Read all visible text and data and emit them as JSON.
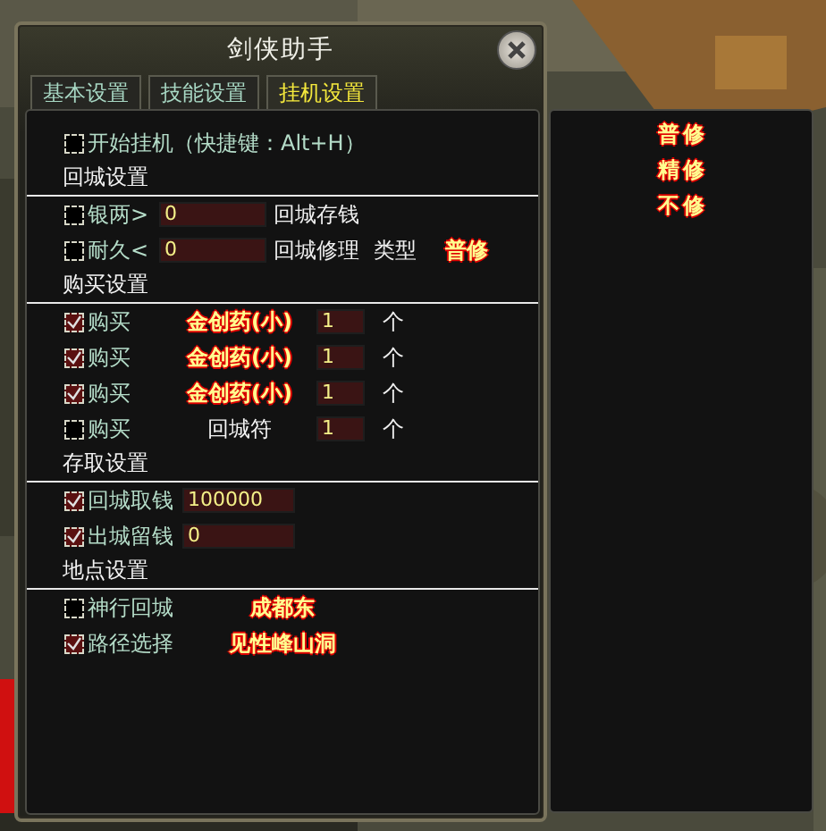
{
  "window": {
    "title": "剑侠助手"
  },
  "tabs": [
    {
      "label": "基本设置",
      "selected": false
    },
    {
      "label": "技能设置",
      "selected": false
    },
    {
      "label": "挂机设置",
      "selected": true
    }
  ],
  "start": {
    "label": "开始挂机（快捷键：Alt+H）",
    "checked": false
  },
  "return_section": {
    "title": "回城设置",
    "silver": {
      "checked": false,
      "label": "银两>",
      "value": "0",
      "action": "回城存钱"
    },
    "durability": {
      "checked": false,
      "label": "耐久<",
      "value": "0",
      "action": "回城修理",
      "type_label": "类型",
      "type_value": "普修"
    }
  },
  "buy_section": {
    "title": "购买设置",
    "items": [
      {
        "checked": true,
        "label": "购买",
        "item": "金创药(小)",
        "highlight": true,
        "quantity": "1",
        "unit": "个"
      },
      {
        "checked": true,
        "label": "购买",
        "item": "金创药(小)",
        "highlight": true,
        "quantity": "1",
        "unit": "个"
      },
      {
        "checked": true,
        "label": "购买",
        "item": "金创药(小)",
        "highlight": true,
        "quantity": "1",
        "unit": "个"
      },
      {
        "checked": false,
        "label": "购买",
        "item": "回城符",
        "highlight": false,
        "quantity": "1",
        "unit": "个"
      }
    ]
  },
  "bank_section": {
    "title": "存取设置",
    "items": [
      {
        "checked": true,
        "label": "回城取钱",
        "value": "100000"
      },
      {
        "checked": true,
        "label": "出城留钱",
        "value": "0"
      }
    ]
  },
  "location_section": {
    "title": "地点设置",
    "items": [
      {
        "checked": false,
        "label": "神行回城",
        "value": "成都东"
      },
      {
        "checked": true,
        "label": "路径选择",
        "value": "见性峰山洞"
      }
    ]
  },
  "repair_options": [
    "普修",
    "精修",
    "不修"
  ]
}
